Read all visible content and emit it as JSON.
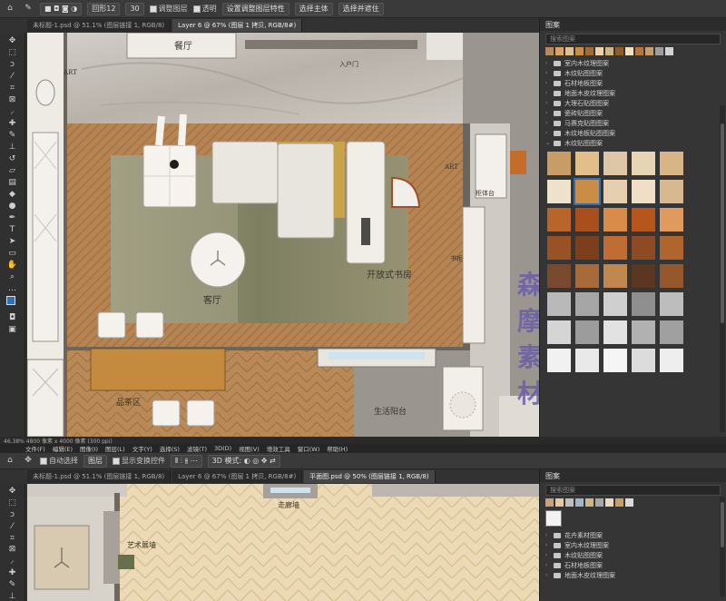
{
  "top_window": {
    "options_bar": {
      "font_field": "回形12",
      "size_field": "30",
      "checkbox_1": "调整图层",
      "checkbox_2": "透明",
      "button_1": "设置调整图层特性",
      "button_2": "选择主体",
      "button_3": "选择并遮住"
    },
    "tabs": [
      {
        "label": "未标题-1.psd @ 51.1% (图层链接 1, RGB/8)",
        "active": false
      },
      {
        "label": "Layer 6 @ 67% (图层 1 拷贝, RGB/8#)",
        "active": true
      }
    ],
    "statusbar": "46.38%   4800 像素 x 4000 像素 (300 ppi)",
    "canvas_labels": {
      "dining": "餐厅",
      "living": "客厅",
      "study": "开放式书房",
      "tea": "品茶区",
      "balcony": "生活阳台",
      "art_left": "ART",
      "art_right": "ART",
      "corridor_small": "入户门",
      "cabinet_small": "柜体台",
      "wall_small": "书柜"
    },
    "panel": {
      "title": "图案",
      "search_placeholder": "搜索图案",
      "folders": [
        "室内木纹理图案",
        "木纹贴图图案",
        "石材地板图案",
        "地面木皮纹理图案",
        "大理石贴图图案",
        "瓷砖贴图图案",
        "马赛克贴图图案",
        "木纹地板贴图图案",
        "木纹贴图图案"
      ]
    },
    "watermark": "森摩素材"
  },
  "menubar": [
    "文件(F)",
    "编辑(E)",
    "图像(I)",
    "图层(L)",
    "文字(Y)",
    "选择(S)",
    "滤镜(T)",
    "3D(D)",
    "视图(V)",
    "增效工具",
    "窗口(W)",
    "帮助(H)"
  ],
  "bottom_window": {
    "options_bar": {
      "auto_select": "自动选择",
      "layer_field": "图层",
      "transform_checkbox": "显示变换控件"
    },
    "tabs": [
      {
        "label": "未标题-1.psd @ 51.1% (图层链接 1, RGB/8)",
        "active": false
      },
      {
        "label": "Layer 6 @ 67% (图层 1 拷贝, RGB/8#)",
        "active": false
      },
      {
        "label": "平面图.psd @ 50% (图层链接 1, RGB/8)",
        "active": true
      }
    ],
    "canvas_labels": {
      "corridor": "走廊墙",
      "art": "艺术展墙"
    },
    "panel": {
      "title": "图案",
      "search_placeholder": "搜索图案",
      "folders": [
        "花卉素材图案",
        "室内木纹理图案",
        "木纹贴图图案",
        "石材地板图案",
        "地面木皮纹理图案"
      ]
    }
  },
  "colors": {
    "accent": "#2f6fb5",
    "wood": "#b78857",
    "marble": "#c9c4bd",
    "rug": "#8f8a6a",
    "herringbone": "#e7d3a8"
  }
}
